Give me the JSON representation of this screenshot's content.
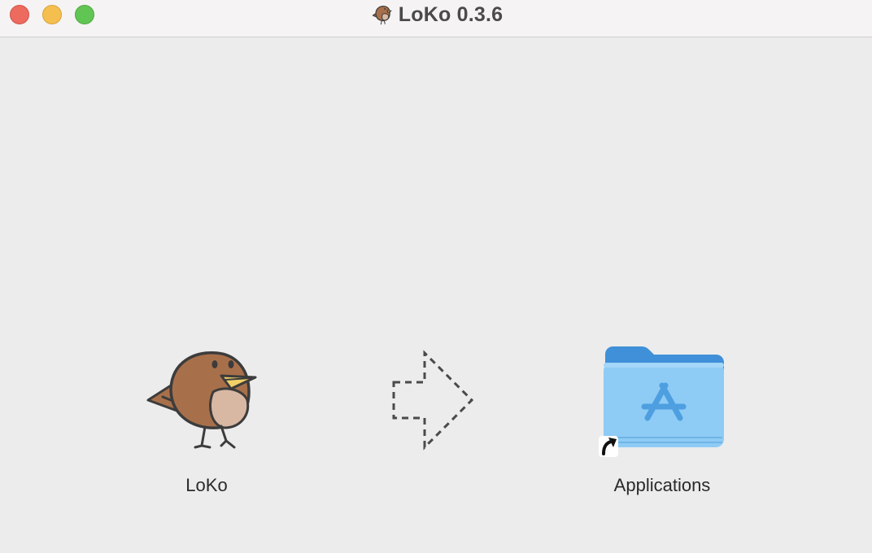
{
  "window": {
    "title": "LoKo 0.3.6"
  },
  "titlebar": {
    "close_button": "close",
    "minimize_button": "minimize",
    "zoom_button": "zoom",
    "title_icon": "bird-icon"
  },
  "installer": {
    "app": {
      "label": "LoKo",
      "icon": "bird-icon"
    },
    "arrow": {
      "icon": "dashed-arrow-icon"
    },
    "destination": {
      "label": "Applications",
      "icon": "applications-folder-icon",
      "alias_icon": "alias-arrow-icon"
    }
  },
  "colors": {
    "background": "#ececec",
    "titlebar": "#f5f3f4",
    "close": "#ed6a5e",
    "minimize": "#f5bf4f",
    "zoom": "#61c554",
    "bird_body": "#a8704a",
    "bird_belly": "#d9b8a3",
    "bird_beak": "#f2d066",
    "folder": "#8ecbf5"
  }
}
